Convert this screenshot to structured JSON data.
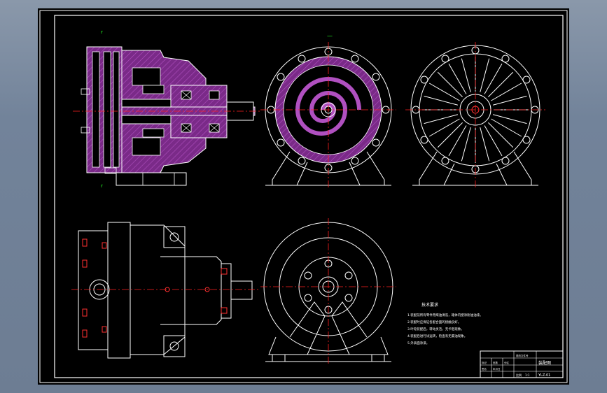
{
  "drawing": {
    "type": "engineering-drawing",
    "section_mark_left": "r",
    "view_marker_top": "—",
    "tech_notes": {
      "heading": "技术要求",
      "lines": [
        "1.装配前所有零件用煤油清洗，箱体内壁涂耐油油漆。",
        "2.装配时应保证各配合面的接触良好。",
        "3.叶轮装配后，转动灵活，无卡阻现象。",
        "4.装配后进行试运转，检查有无漏油现象。",
        "5.外表面涂漆。"
      ]
    },
    "title_block": {
      "name": "装配图",
      "drawing_no": "YLZ-01",
      "row_labels": [
        "标记",
        "处数",
        "分区",
        "更改文件号",
        "签名",
        "年月日"
      ],
      "scale_label": "比例",
      "scale": "1:1"
    },
    "colors": {
      "frame": "#ffffff",
      "outline": "#ffffff",
      "centerline": "#ff2020",
      "section_hatch": "#7a2a88",
      "hidden_red": "#ff3030"
    }
  }
}
